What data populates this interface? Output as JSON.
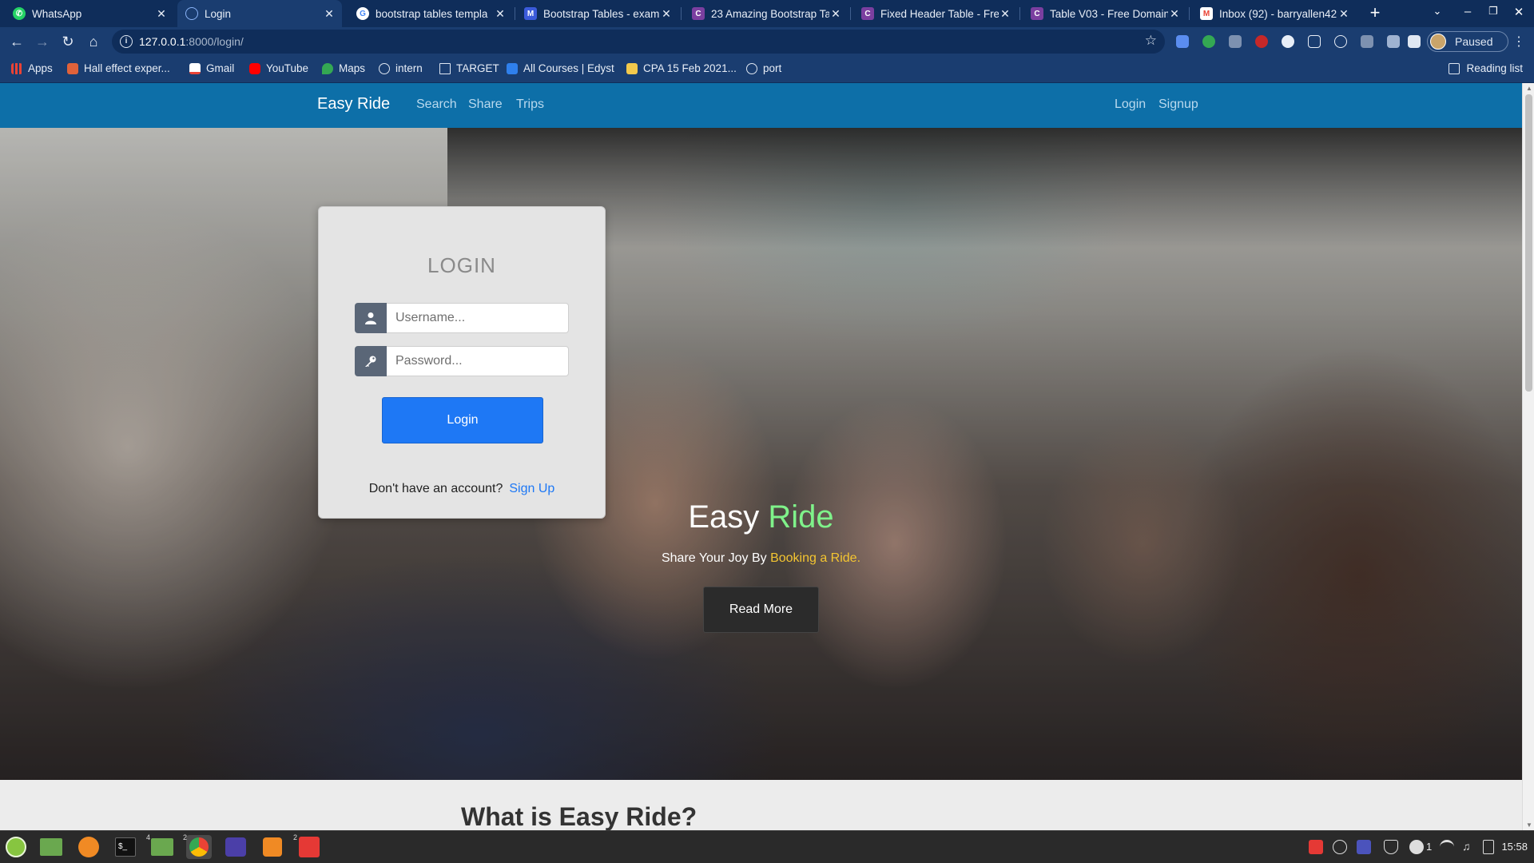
{
  "browser": {
    "tabs": [
      {
        "title": "WhatsApp",
        "favicon": "whatsapp-icon",
        "color": "#25d366"
      },
      {
        "title": "Login",
        "favicon": "globe-icon",
        "color": "#8ab4f8",
        "active": true
      },
      {
        "title": "bootstrap tables templa",
        "favicon": "google-icon",
        "color": "#ffffff"
      },
      {
        "title": "Bootstrap Tables - exam",
        "favicon": "mdb-icon",
        "color": "#3b5bdb"
      },
      {
        "title": "23 Amazing Bootstrap Ta",
        "favicon": "colorlib-icon",
        "color": "#7b3fa0"
      },
      {
        "title": "Fixed Header Table - Fre",
        "favicon": "colorlib-icon",
        "color": "#7b3fa0"
      },
      {
        "title": "Table V03 - Free Domain",
        "favicon": "colorlib-icon",
        "color": "#7b3fa0"
      },
      {
        "title": "Inbox (92) - barryallen42",
        "favicon": "gmail-icon",
        "color": "#ea4335"
      }
    ],
    "url_host": "127.0.0.1",
    "url_rest": ":8000/login/",
    "profile_status": "Paused",
    "bookmarks": [
      {
        "label": "Apps",
        "icon": "apps-grid-icon",
        "color": "#ea4335"
      },
      {
        "label": "Hall effect exper...",
        "icon": "bookmark-favicon",
        "color": "#e0623a"
      },
      {
        "label": "Gmail",
        "icon": "gmail-icon",
        "color": "#ea4335"
      },
      {
        "label": "YouTube",
        "icon": "youtube-icon",
        "color": "#ff0000"
      },
      {
        "label": "Maps",
        "icon": "maps-icon",
        "color": "#34a853"
      },
      {
        "label": "intern",
        "icon": "globe-icon",
        "color": "#dfe7f2"
      },
      {
        "label": "TARGET",
        "icon": "document-icon",
        "color": "#dfe7f2"
      },
      {
        "label": "All Courses | Edyst",
        "icon": "edyst-icon",
        "color": "#2f80ed"
      },
      {
        "label": "CPA 15 Feb 2021...",
        "icon": "bookmark-favicon",
        "color": "#f2c94c"
      },
      {
        "label": "port",
        "icon": "globe-icon",
        "color": "#dfe7f2"
      }
    ],
    "reading_list": "Reading list"
  },
  "site": {
    "brand": "Easy Ride",
    "nav_left": [
      "Search",
      "Share",
      "Trips"
    ],
    "nav_right": [
      "Login",
      "Signup"
    ],
    "colors": {
      "navbar": "#0d6fa8",
      "primary_button": "#1e78f5",
      "hero_accent": "#7ff28a",
      "sub_accent": "#f4c531"
    }
  },
  "login": {
    "title": "LOGIN",
    "username_placeholder": "Username...",
    "password_placeholder": "Password...",
    "button": "Login",
    "no_account": "Don't have an account?",
    "signup_link": "Sign Up"
  },
  "hero": {
    "title_main": "Easy",
    "title_accent": "Ride",
    "subtitle_main": "Share Your Joy By",
    "subtitle_accent": "Booking a Ride.",
    "button": "Read More"
  },
  "section": {
    "heading": "What is Easy Ride?"
  },
  "taskbar": {
    "clock": "15:58",
    "notification_count": "1",
    "badges": {
      "files": "4",
      "chrome": "2",
      "anydesk": "2"
    }
  }
}
